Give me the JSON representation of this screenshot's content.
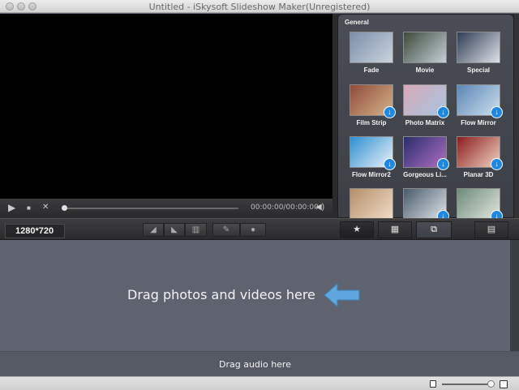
{
  "window": {
    "title": "Untitled - iSkysoft Slideshow Maker(Unregistered)"
  },
  "player": {
    "timecode": "00:00:00/00:00:00",
    "progress": 0
  },
  "transitions": {
    "section_label": "General",
    "items": [
      {
        "label": "Fade",
        "download": false,
        "colors": [
          "#7c8fa8",
          "#c9d3de"
        ]
      },
      {
        "label": "Movie",
        "download": false,
        "colors": [
          "#3d4a3a",
          "#c4cfd8"
        ]
      },
      {
        "label": "Special",
        "download": false,
        "colors": [
          "#2f3c53",
          "#dfe3ea"
        ]
      },
      {
        "label": "Film Strip",
        "download": true,
        "colors": [
          "#8f4b3a",
          "#d5b38a"
        ]
      },
      {
        "label": "Photo Matrix",
        "download": true,
        "colors": [
          "#d8a9b7",
          "#a6c4e0"
        ]
      },
      {
        "label": "Flow Mirror",
        "download": true,
        "colors": [
          "#5b86b5",
          "#cfe0ef"
        ]
      },
      {
        "label": "Flow Mirror2",
        "download": true,
        "colors": [
          "#2d8fd1",
          "#eaf2f8"
        ]
      },
      {
        "label": "Gorgeous Li...",
        "download": true,
        "colors": [
          "#2a2d6b",
          "#b06ec4"
        ]
      },
      {
        "label": "Planar 3D",
        "download": true,
        "colors": [
          "#8b1d1d",
          "#f0d2c2"
        ]
      },
      {
        "label": "",
        "download": false,
        "colors": [
          "#b48f6a",
          "#f0dcc6"
        ]
      },
      {
        "label": "",
        "download": true,
        "colors": [
          "#4a5a6b",
          "#dfe5ea"
        ]
      },
      {
        "label": "",
        "download": true,
        "colors": [
          "#6d8a7a",
          "#e4e7e0"
        ]
      }
    ]
  },
  "toolbar": {
    "resolution": "1280*720"
  },
  "workspace": {
    "drop_text": "Drag photos and videos here",
    "audio_text": "Drag audio here"
  },
  "colors": {
    "accent": "#1e88e5",
    "arrow": "#5ea6dd"
  }
}
